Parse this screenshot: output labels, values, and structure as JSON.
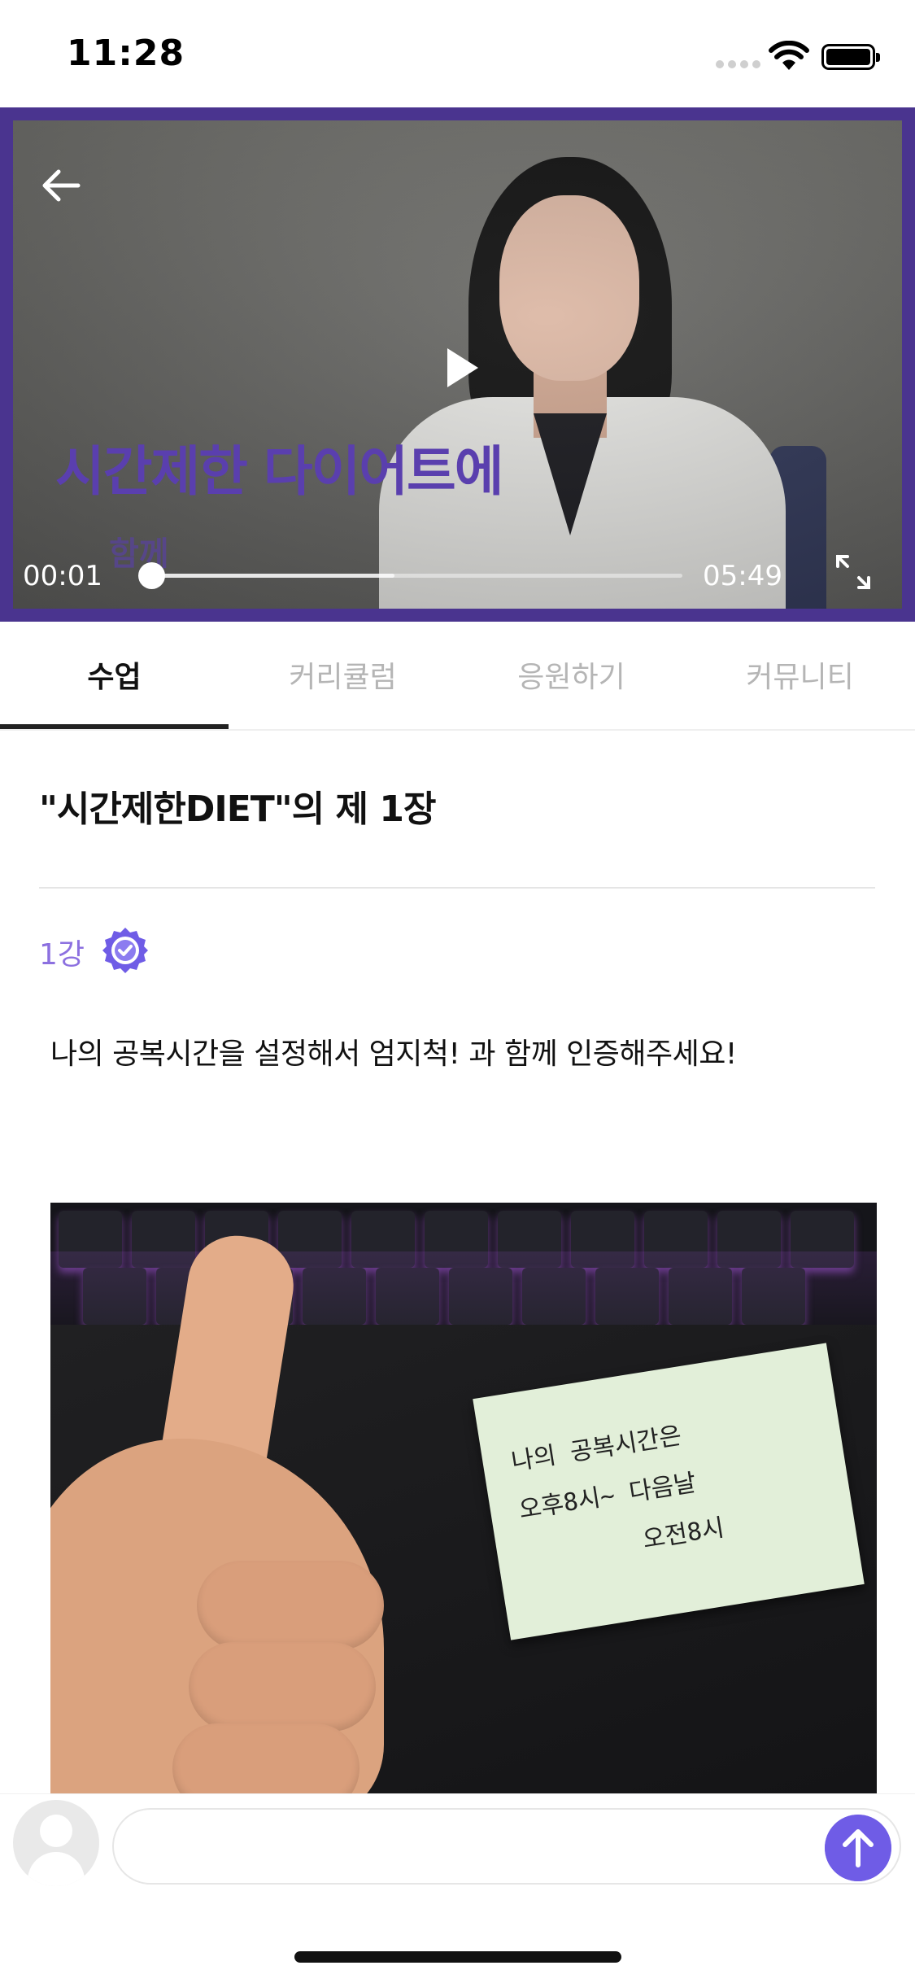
{
  "status_bar": {
    "time": "11:28"
  },
  "video": {
    "caption": "시간제한 다이어트에",
    "caption_sub": "함께",
    "current_time": "00:01",
    "total_time": "05:49",
    "progress_fraction": 0.003,
    "buffered_fraction": 0.46
  },
  "tabs": [
    {
      "label": "수업",
      "active": true
    },
    {
      "label": "커리큘럼",
      "active": false
    },
    {
      "label": "응원하기",
      "active": false
    },
    {
      "label": "커뮤니티",
      "active": false
    }
  ],
  "lesson": {
    "title": "\"시간제한DIET\"의 제 1장",
    "episode_label": "1강",
    "description": "나의 공복시간을 설정해서 엄지척! 과 함께 인증해주세요!"
  },
  "photo": {
    "note_text": "나의 공복시간은\n오후8시~ 다음날\n        오전8시"
  },
  "composer": {
    "placeholder": ""
  },
  "colors": {
    "accent": "#6f5ce6",
    "player_border": "#4a348f",
    "episode": "#8c70e0"
  }
}
